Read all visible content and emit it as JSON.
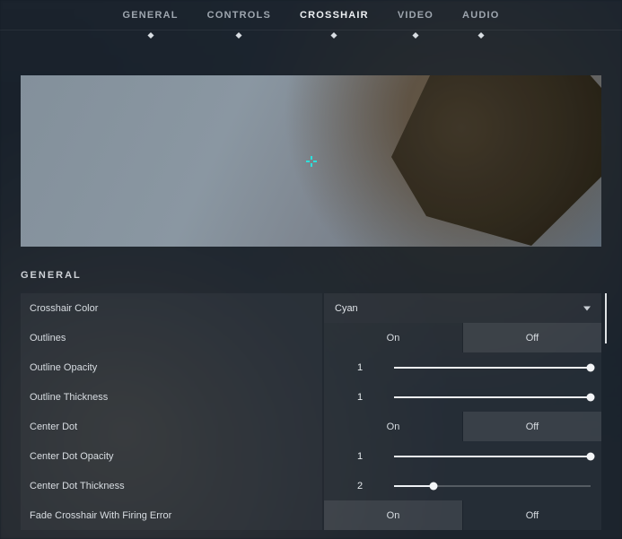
{
  "tabs": [
    {
      "label": "GENERAL",
      "active": false
    },
    {
      "label": "CONTROLS",
      "active": false
    },
    {
      "label": "CROSSHAIR",
      "active": true
    },
    {
      "label": "VIDEO",
      "active": false
    },
    {
      "label": "AUDIO",
      "active": false
    }
  ],
  "section_title": "GENERAL",
  "toggle_labels": {
    "on": "On",
    "off": "Off"
  },
  "settings": {
    "crosshair_color": {
      "label": "Crosshair Color",
      "type": "dropdown",
      "value": "Cyan"
    },
    "outlines": {
      "label": "Outlines",
      "type": "toggle",
      "value": "Off"
    },
    "outline_opacity": {
      "label": "Outline Opacity",
      "type": "slider",
      "value": "1",
      "percent": 100
    },
    "outline_thickness": {
      "label": "Outline Thickness",
      "type": "slider",
      "value": "1",
      "percent": 100
    },
    "center_dot": {
      "label": "Center Dot",
      "type": "toggle",
      "value": "Off"
    },
    "center_dot_opacity": {
      "label": "Center Dot Opacity",
      "type": "slider",
      "value": "1",
      "percent": 100
    },
    "center_dot_thickness": {
      "label": "Center Dot Thickness",
      "type": "slider",
      "value": "2",
      "percent": 20
    },
    "fade_firing_error": {
      "label": "Fade Crosshair With Firing Error",
      "type": "toggle",
      "value": "On"
    }
  },
  "crosshair_colorhex": "#2de0dc"
}
